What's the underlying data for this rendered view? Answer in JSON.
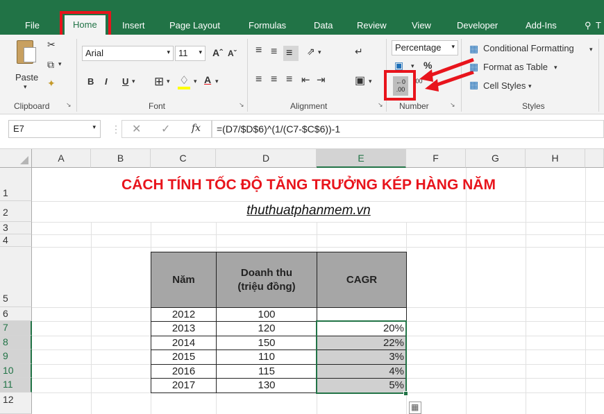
{
  "tabs": [
    "File",
    "Home",
    "Insert",
    "Page Layout",
    "Formulas",
    "Data",
    "Review",
    "View",
    "Developer",
    "Add-Ins"
  ],
  "tell_me": "T",
  "ribbon": {
    "paste": "Paste",
    "font_name": "Arial",
    "font_size": "11",
    "number_format": "Percentage",
    "conditional_formatting": "Conditional Formatting",
    "format_as_table": "Format as Table",
    "cell_styles": "Cell Styles",
    "groups": [
      "Clipboard",
      "Font",
      "Alignment",
      "Number",
      "Styles"
    ],
    "bold": "B",
    "italic": "I",
    "underline": "U",
    "increase_decimal": ".00",
    "decrease_decimal": "←0 .00"
  },
  "formula_bar": {
    "name_box": "E7",
    "fx": "fx",
    "formula": "=(D7/$D$6)^(1/(C7-$C$6))-1"
  },
  "columns": [
    "A",
    "B",
    "C",
    "D",
    "E",
    "F",
    "G",
    "H"
  ],
  "rows": [
    "1",
    "2",
    "3",
    "4",
    "5",
    "6",
    "7",
    "8",
    "9",
    "10",
    "11",
    "12"
  ],
  "sheet": {
    "title": "CÁCH TÍNH TỐC ĐỘ TĂNG TRƯỞNG KÉP HÀNG NĂM",
    "subtitle": "thuthuatphanmem.vn",
    "headers": [
      "Năm",
      "Doanh thu\n(triệu đồng)",
      "CAGR"
    ],
    "header_line1": "Doanh thu",
    "header_line2": "(triệu đồng)",
    "table": [
      [
        "2012",
        "100",
        ""
      ],
      [
        "2013",
        "120",
        "20%"
      ],
      [
        "2014",
        "150",
        "22%"
      ],
      [
        "2015",
        "110",
        "3%"
      ],
      [
        "2016",
        "115",
        "4%"
      ],
      [
        "2017",
        "130",
        "5%"
      ]
    ]
  },
  "colors": {
    "excel_green": "#217346",
    "highlight_red": "#e8141c",
    "header_fill": "#a6a6a6"
  }
}
